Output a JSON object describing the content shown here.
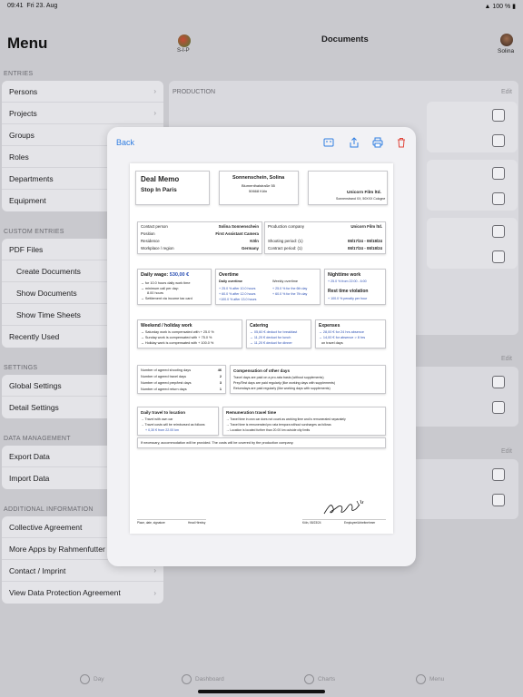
{
  "status": {
    "time": "09:41",
    "date": "Fri 23. Aug",
    "battery": "100 %"
  },
  "menu": {
    "title": "Menu",
    "entries_label": "ENTRIES",
    "entries": [
      "Persons",
      "Projects",
      "Groups",
      "Roles",
      "Departments",
      "Equipment"
    ],
    "custom_label": "CUSTOM ENTRIES",
    "custom": [
      "PDF Files",
      "Create Documents",
      "Show Documents",
      "Show Time Sheets",
      "Recently Used"
    ],
    "settings_label": "SETTINGS",
    "settings": [
      "Global Settings",
      "Detail Settings"
    ],
    "data_label": "DATA MANAGEMENT",
    "data": [
      "Export Data",
      "Import Data"
    ],
    "info_label": "ADDITIONAL INFORMATION",
    "info": [
      "Collective Agreement",
      "More Apps by Rahmenfutter",
      "Contact / Imprint",
      "View Data Protection Agreement"
    ]
  },
  "header": {
    "title": "Documents",
    "sip": "S-I-P",
    "user": "Solina"
  },
  "production": {
    "label": "PRODUCTION",
    "edit": "Edit",
    "edit2": "Edit",
    "edit3": "Edit"
  },
  "modal": {
    "back": "Back"
  },
  "doc": {
    "title": "Deal Memo",
    "subtitle": "Stop In Paris",
    "person_name": "Sonnenschein, Solina",
    "person_street": "Blumenthalstraße 55",
    "person_city": "50668 Köln",
    "company_logo": "Unicorn Film ltd.",
    "company_addr": "Sonnenstrand XX, 50XXX Cologne",
    "contact_label": "Contact person",
    "contact_value": "Solina Sonnenschein",
    "position_label": "Position",
    "position_value": "First Assistant Camera",
    "residence_label": "Residence",
    "residence_value": "Köln",
    "workplace_label": "Workplace / region",
    "workplace_value": "Germany",
    "company_label": "Production company",
    "company_value": "Unicorn Film ltd.",
    "shooting_label": "Shooting period: (1)",
    "shooting_value": "08/17/24 - 08/18/24",
    "contract_label": "Contract period: (1)",
    "contract_value": "08/17/24 - 08/18/24",
    "wage_label": "Daily wage:",
    "wage_value": "530,00 €",
    "wage_l1": "→ for 10.0 hours daily work time",
    "wage_l2": "→ minimum call per day:",
    "wage_l3": "8.00 hours",
    "wage_l4": "→ Settlement via income tax card",
    "ot_title": "Overtime",
    "ot_daily": "Daily overtime",
    "ot_weekly": "Weekly overtime",
    "ot_d1": "+ 25.0 % after 10.0 hours",
    "ot_d2": "+ 60.0 % after 12.0 hours",
    "ot_d3": "+100.0 % after 13.0 hours",
    "ot_w1": "+ 25.0 % for the 6th day",
    "ot_w2": "+ 60.0 % for the 7th day",
    "night_title": "Nighttime work",
    "night_l1": "+ 25.0 % from 22:00 - 6:00",
    "rest_title": "Rest time violation",
    "rest_l1": "+ 100.0 % penalty per hour",
    "weekend_title": "Weekend / holiday work",
    "weekend_l1": "→ Saturday work is compensated with + 25.0 %",
    "weekend_l2": "→ Sunday work is compensated with + 75.0 %",
    "weekend_l3": "→ Holiday work is compensated with + 100.0 %",
    "catering_title": "Catering",
    "catering_l1": "→ 05,60 € deduct for breakfast",
    "catering_l2": "→ 11,20 € deduct for lunch",
    "catering_l3": "→ 11,20 € deduct for dinner",
    "expenses_title": "Expenses",
    "expenses_l1": "→ 28,00 € for 24 hrs absence",
    "expenses_l2": "→ 14,00 € for absence > 8 hrs",
    "expenses_l3": "on travel days",
    "agreed_shoot_label": "Number of agreed shooting days",
    "agreed_shoot": "46",
    "agreed_travel_label": "Number of agreed travel days",
    "agreed_travel": "2",
    "agreed_prep_label": "Number of agreed prep/test days",
    "agreed_prep": "3",
    "agreed_return_label": "Number of agreed return days",
    "agreed_return": "1",
    "comp_title": "Compensation of other days",
    "comp_l1": "Travel days are paid on a pro-rata basis (without supplements)",
    "comp_l2": "Prep/Test days are paid regularly (like working days with supplements)",
    "comp_l3": "Returndays are paid regularly (like working days with supplements)",
    "daily_travel_title": "Daily travel to location",
    "dt_l1": "→ Travel with own car",
    "dt_l2": "→ Travel costs will be reimbursed as follows",
    "dt_l3": "+ 0,30 € from 22.00 km",
    "rem_title": "Remuneration travel time",
    "rem_l1": "→ Travel time in own car does not count as working time and is remunerated separately",
    "rem_l2": "→ Travel time is remunerated pro rata tempora without surcharges as follows",
    "rem_l3": "→ Location is located further than 20.00 km outside city limits",
    "accommodation": "If necessary, accommodation will be provided. The costs will be covered by the production company.",
    "foot_place": "Place, date, signature",
    "foot_head": "Head Hiredsy",
    "foot_koln": "Köln, 08/23/24",
    "foot_emp": "Employee/Arbeitnehmer"
  },
  "tabs": [
    "Day",
    "Dashboard",
    "Charts",
    "Menu"
  ]
}
